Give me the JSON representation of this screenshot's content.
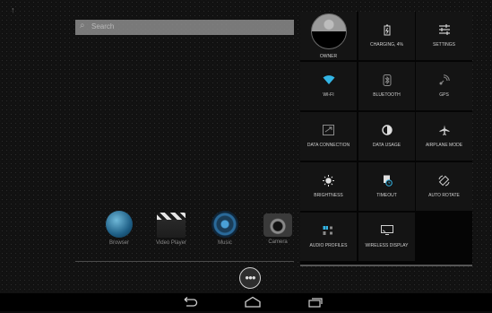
{
  "search": {
    "placeholder": "Search"
  },
  "dock": [
    {
      "label": "Browser",
      "icon": "browser-icon"
    },
    {
      "label": "Video Player",
      "icon": "video-player-icon"
    },
    {
      "label": "Music",
      "icon": "music-icon"
    },
    {
      "label": "Camera",
      "icon": "camera-icon"
    }
  ],
  "quick_settings": {
    "tiles": [
      {
        "label": "OWNER",
        "icon": "owner-avatar"
      },
      {
        "label": "CHARGING, 4%",
        "icon": "battery-icon"
      },
      {
        "label": "SETTINGS",
        "icon": "settings-sliders-icon"
      },
      {
        "label": "WI-FI",
        "icon": "wifi-icon"
      },
      {
        "label": "BLUETOOTH",
        "icon": "bluetooth-icon"
      },
      {
        "label": "GPS",
        "icon": "gps-icon"
      },
      {
        "label": "DATA CONNECTION",
        "icon": "data-connection-icon"
      },
      {
        "label": "DATA USAGE",
        "icon": "data-usage-icon"
      },
      {
        "label": "AIRPLANE MODE",
        "icon": "airplane-icon"
      },
      {
        "label": "BRIGHTNESS",
        "icon": "brightness-icon"
      },
      {
        "label": "TIMEOUT",
        "icon": "timeout-icon"
      },
      {
        "label": "AUTO ROTATE",
        "icon": "rotate-icon"
      },
      {
        "label": "AUDIO PROFILES",
        "icon": "audio-profiles-icon"
      },
      {
        "label": "WIRELESS DISPLAY",
        "icon": "wireless-display-icon"
      }
    ]
  },
  "colors": {
    "accent": "#33b5e5",
    "panel_bg": "#050505",
    "tile_bg": "#141414"
  }
}
